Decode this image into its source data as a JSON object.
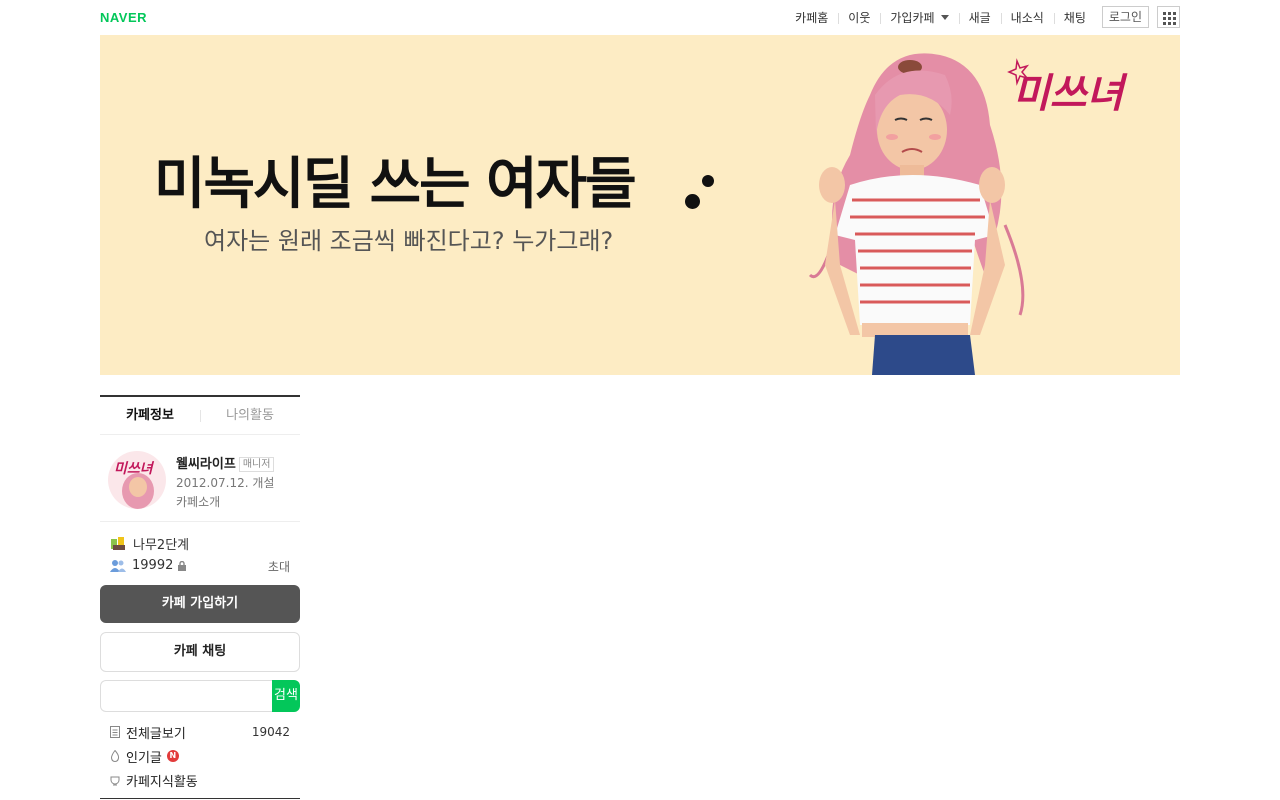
{
  "header": {
    "logo": "NAVER",
    "nav": [
      {
        "label": "카페홈"
      },
      {
        "label": "이웃"
      },
      {
        "label": "가입카페"
      },
      {
        "label": "새글"
      },
      {
        "label": "내소식"
      },
      {
        "label": "채팅"
      }
    ],
    "login_label": "로그인",
    "apps_icon": "grid-icon"
  },
  "banner": {
    "title": "미녹시딜 쓰는 여자들",
    "subtitle": "여자는 원래 조금씩 빠진다고? 누가그래?",
    "brand_logo_text": "미쓰녀",
    "background": "#fdecc4"
  },
  "sidebar": {
    "tabs": [
      {
        "label": "카페정보",
        "active": true
      },
      {
        "label": "나의활동",
        "active": false
      }
    ],
    "profile": {
      "name": "웰씨라이프",
      "badge": "매니저",
      "created": "2012.07.12. 개설",
      "intro_link": "카페소개",
      "avatar_text": "미쓰녀"
    },
    "level_label": "나무2단계",
    "member_count": "19992",
    "invite_label": "초대",
    "join_button": "카페 가입하기",
    "chat_button": "카페 채팅",
    "search": {
      "placeholder": "",
      "button_label": "검색"
    },
    "menu": {
      "all_posts": {
        "label": "전체글보기",
        "count": "19042"
      },
      "popular": {
        "label": "인기글",
        "badge": "N"
      },
      "knowledge": {
        "label": "카페지식활동"
      }
    }
  },
  "colors": {
    "brand_green": "#03c75a",
    "join_button_bg": "#555555",
    "new_badge": "#e23b3b"
  }
}
